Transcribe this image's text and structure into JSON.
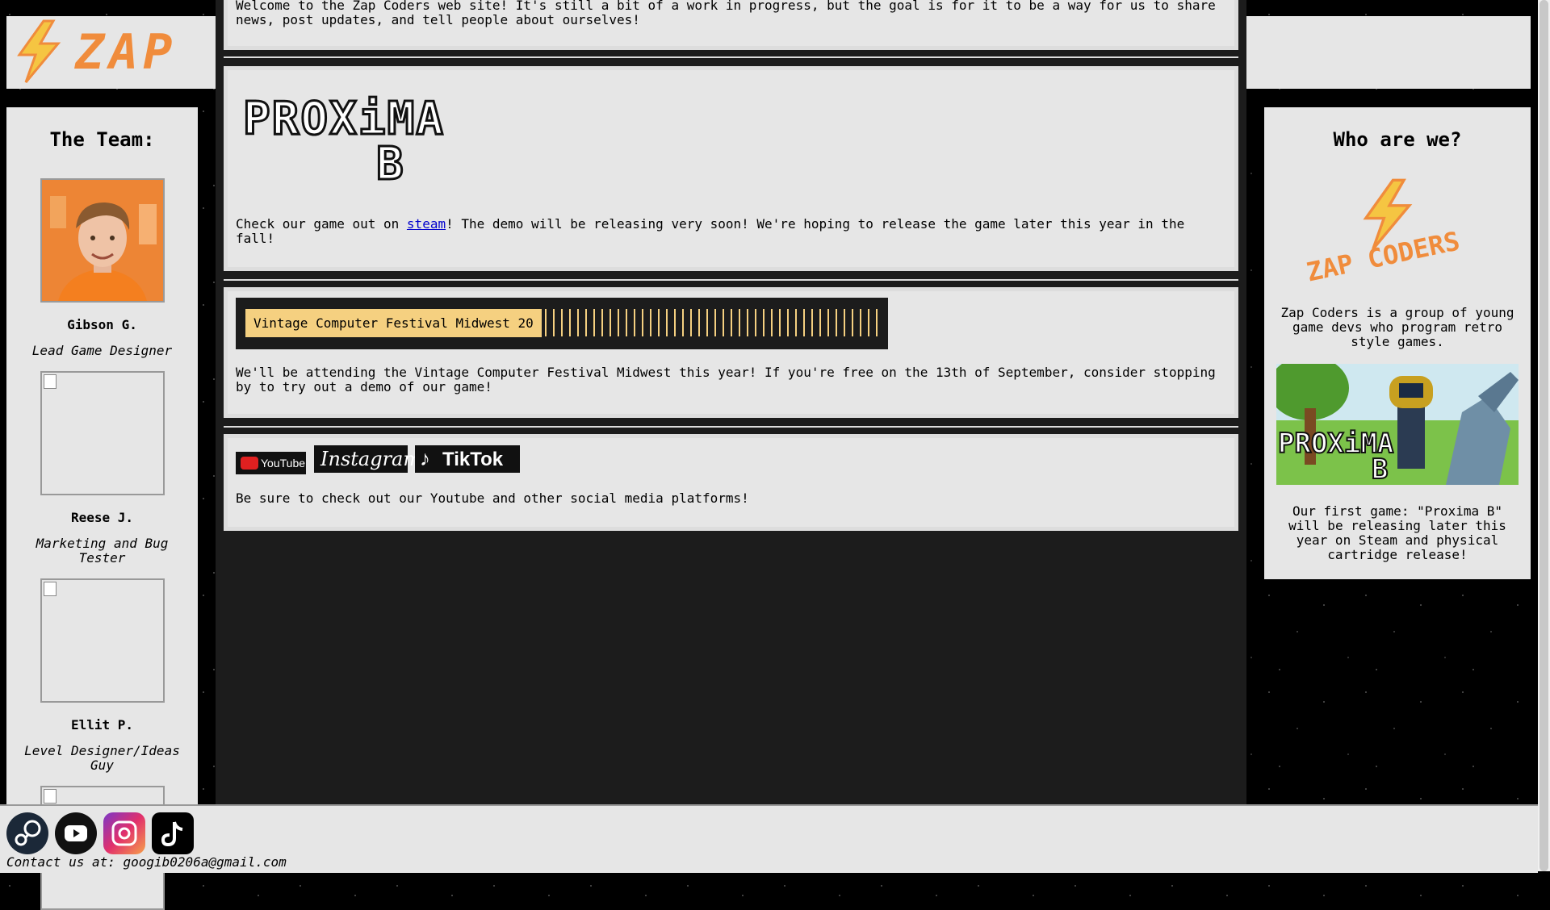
{
  "header": {
    "logo_text": "ZAP C"
  },
  "team": {
    "title": "The Team:",
    "members": [
      {
        "name": "Gibson G.",
        "role": "Lead Game Designer"
      },
      {
        "name": "Reese J.",
        "role": "Marketing and Bug Tester"
      },
      {
        "name": "Ellit P.",
        "role": "Level Designer/Ideas Guy"
      }
    ]
  },
  "main": {
    "intro": "Welcome to the Zap Coders web site! It's still a bit of a work in progress, but the goal is for it to be a way for us to share news, post updates, and tell people about ourselves!",
    "game_logo_line1": "PROXiMA",
    "game_logo_line2": "B",
    "game_text_before": "Check our game out on ",
    "game_link": "steam",
    "game_text_after": "! The demo will be releasing very soon! We're hoping to release the game later this year in the fall!",
    "event_label": "Vintage Computer Festival Midwest 20",
    "event_text": "We'll be attending the Vintage Computer Festival Midwest this year! If you're free on the 13th of September, consider stopping by to try out a demo of our game!",
    "social_youtube": "YouTube",
    "social_instagram": "Instagram",
    "social_tiktok": "TikTok",
    "social_text": "Be sure to check out our Youtube and other social media platforms!"
  },
  "about": {
    "title": "Who are we?",
    "logo_text": "ZAP CODERS",
    "description": "Zap Coders is a group of young game devs who program retro style games.",
    "game_art_text_1": "PROXiMA",
    "game_art_text_2": "B",
    "game_description": "Our first game: \"Proxima B\" will be releasing later this year on Steam and physical cartridge release!"
  },
  "footer": {
    "contact": "Contact us at: googib0206a@gmail.com"
  },
  "colors": {
    "accent_orange": "#f08c3c",
    "bolt_yellow": "#f5c542",
    "marquee_gold": "#f5d080"
  }
}
